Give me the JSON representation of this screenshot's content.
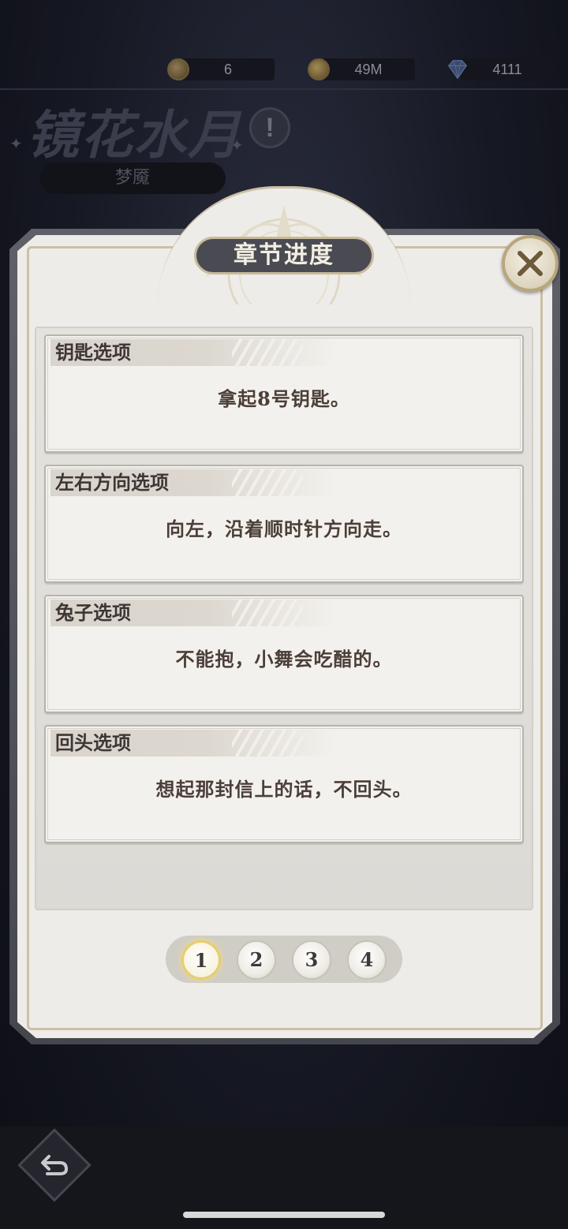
{
  "currencies": [
    {
      "icon": "bronze-coin-icon",
      "value": "6"
    },
    {
      "icon": "gold-coin-icon",
      "value": "49M"
    },
    {
      "icon": "diamond-icon",
      "value": "4111"
    }
  ],
  "stage": {
    "title": "镜花水月",
    "subtitle": "梦魇",
    "help_label": "!"
  },
  "dialog": {
    "title": "章节进度",
    "close_icon": "close-icon",
    "cards": [
      {
        "title": "钥匙选项",
        "text": "拿起8号钥匙。"
      },
      {
        "title": "左右方向选项",
        "text": "向左，沿着顺时针方向走。"
      },
      {
        "title": "兔子选项",
        "text": "不能抱，小舞会吃醋的。"
      },
      {
        "title": "回头选项",
        "text": "想起那封信上的话，不回头。"
      }
    ],
    "pages": [
      "1",
      "2",
      "3",
      "4"
    ],
    "active_page": "1"
  },
  "colors": {
    "accent_gold": "#e8cd6a",
    "panel_bg": "#eeece8",
    "header_bg": "#4a4b52"
  },
  "footer": {
    "back_icon": "back-arrow-icon"
  }
}
